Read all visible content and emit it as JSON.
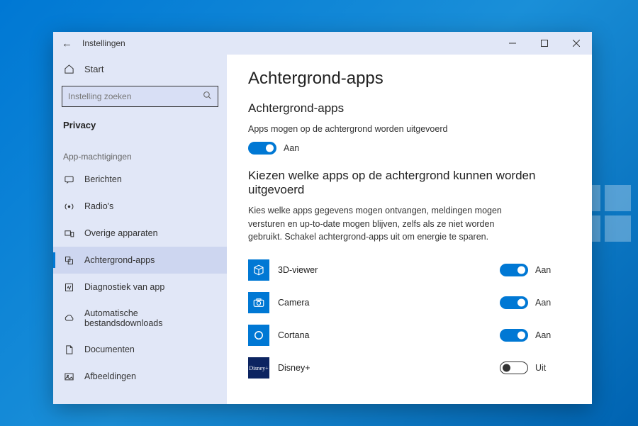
{
  "window": {
    "title": "Instellingen"
  },
  "sidebar": {
    "home": "Start",
    "search_placeholder": "Instelling zoeken",
    "category": "Privacy",
    "subheading": "App-machtigingen",
    "items": [
      {
        "label": "Berichten"
      },
      {
        "label": "Radio's"
      },
      {
        "label": "Overige apparaten"
      },
      {
        "label": "Achtergrond-apps"
      },
      {
        "label": "Diagnostiek van app"
      },
      {
        "label": "Automatische bestandsdownloads"
      },
      {
        "label": "Documenten"
      },
      {
        "label": "Afbeeldingen"
      }
    ]
  },
  "main": {
    "title": "Achtergrond-apps",
    "section1_heading": "Achtergrond-apps",
    "section1_desc": "Apps mogen op de achtergrond worden uitgevoerd",
    "master_toggle_label": "Aan",
    "section2_heading": "Kiezen welke apps op de achtergrond kunnen worden uitgevoerd",
    "section2_desc": "Kies welke apps gegevens mogen ontvangen, meldingen mogen versturen en up-to-date mogen blijven, zelfs als ze niet worden gebruikt. Schakel achtergrond-apps uit om energie te sparen.",
    "apps": [
      {
        "name": "3D-viewer",
        "toggle_label": "Aan",
        "on": true
      },
      {
        "name": "Camera",
        "toggle_label": "Aan",
        "on": true
      },
      {
        "name": "Cortana",
        "toggle_label": "Aan",
        "on": true
      },
      {
        "name": "Disney+",
        "toggle_label": "Uit",
        "on": false
      }
    ]
  }
}
